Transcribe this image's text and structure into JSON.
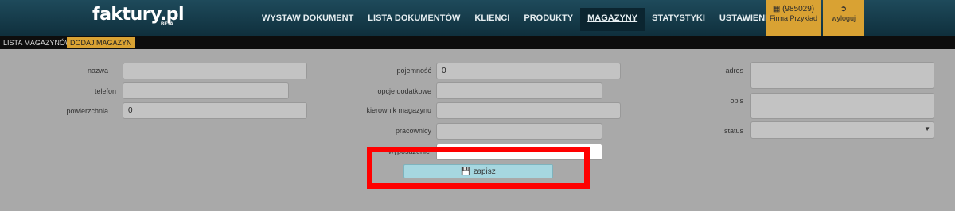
{
  "brand": {
    "logo": "faktury.pl",
    "badge": "BETA"
  },
  "nav": [
    "WYSTAW DOKUMENT",
    "LISTA DOKUMENTÓW",
    "KLIENCI",
    "PRODUKTY",
    "MAGAZYNY",
    "STATYSTYKI",
    "USTAWIENIA"
  ],
  "nav_active": "MAGAZYNY",
  "user": {
    "id": "(985029)",
    "firm": "Firma Przykład",
    "logout": "wyloguj"
  },
  "subnav": {
    "list": "LISTA MAGAZYNÓW",
    "add": "DODAJ MAGAZYN"
  },
  "form": {
    "nazwa": {
      "label": "nazwa",
      "value": ""
    },
    "telefon": {
      "label": "telefon",
      "value": ""
    },
    "powierzchnia": {
      "label": "powierzchnia",
      "value": "0"
    },
    "pojemnosc": {
      "label": "pojemność",
      "value": "0"
    },
    "opcje": {
      "label": "opcje dodatkowe",
      "value": ""
    },
    "kierownik": {
      "label": "kierownik magazynu",
      "value": ""
    },
    "pracownicy": {
      "label": "pracownicy",
      "value": ""
    },
    "wyposazenie": {
      "label": "wyposażenie",
      "value": ""
    },
    "adres": {
      "label": "adres",
      "value": ""
    },
    "opis": {
      "label": "opis",
      "value": ""
    },
    "status": {
      "label": "status",
      "value": ""
    }
  },
  "save_label": "zapisz",
  "colors": {
    "accent": "#d9a233",
    "header": "#1e4a5b",
    "highlight": "#ff0000",
    "button": "#a6d7e0"
  }
}
